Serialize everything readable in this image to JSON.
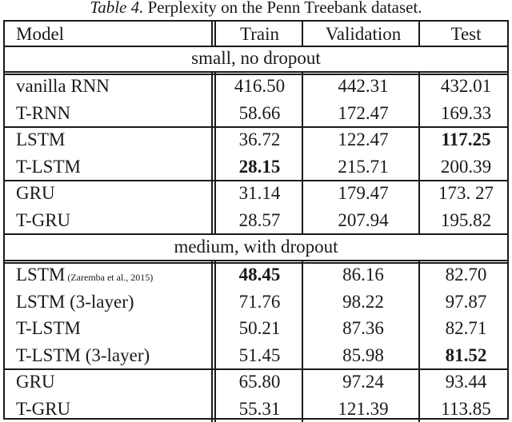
{
  "caption": {
    "label": "Table 4.",
    "text": " Perplexity on the Penn Treebank dataset."
  },
  "header": {
    "model": "Model",
    "train": "Train",
    "validation": "Validation",
    "test": "Test"
  },
  "sections": [
    {
      "title": "small, no dropout",
      "groups": [
        [
          {
            "model": "vanilla RNN",
            "train": "416.50",
            "validation": "442.31",
            "test": "432.01"
          },
          {
            "model": "T-RNN",
            "train": "58.66",
            "validation": "172.47",
            "test": "169.33"
          }
        ],
        [
          {
            "model": "LSTM",
            "train": "36.72",
            "validation": "122.47",
            "test": "117.25",
            "bold": "test"
          },
          {
            "model": "T-LSTM",
            "train": "28.15",
            "validation": "215.71",
            "test": "200.39",
            "bold": "train"
          }
        ],
        [
          {
            "model": "GRU",
            "train": "31.14",
            "validation": "179.47",
            "test": "173. 27"
          },
          {
            "model": "T-GRU",
            "train": "28.57",
            "validation": "207.94",
            "test": "195.82"
          }
        ]
      ]
    },
    {
      "title": "medium, with dropout",
      "groups": [
        [
          {
            "model": "LSTM",
            "citation": "(Zaremba et al., 2015)",
            "train": "48.45",
            "validation": "86.16",
            "test": "82.70",
            "bold": "train"
          },
          {
            "model": "LSTM (3-layer)",
            "train": "71.76",
            "validation": "98.22",
            "test": "97.87"
          },
          {
            "model": "T-LSTM",
            "train": "50.21",
            "validation": "87.36",
            "test": "82.71"
          },
          {
            "model": "T-LSTM (3-layer)",
            "train": "51.45",
            "validation": "85.98",
            "test": "81.52",
            "bold": "test"
          }
        ],
        [
          {
            "model": "GRU",
            "train": "65.80",
            "validation": "97.24",
            "test": "93.44"
          },
          {
            "model": "T-GRU",
            "train": "55.31",
            "validation": "121.39",
            "test": "113.85"
          }
        ]
      ]
    }
  ]
}
